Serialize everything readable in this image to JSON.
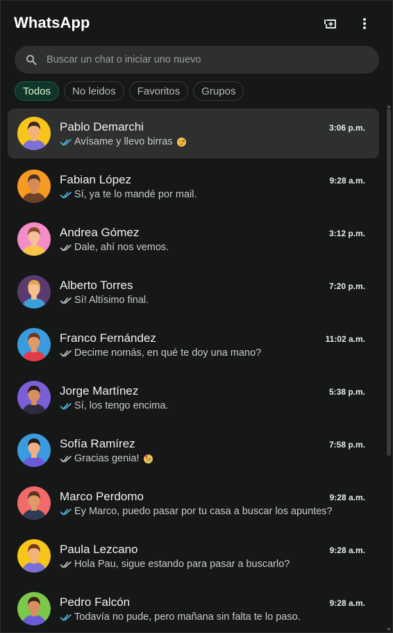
{
  "app": {
    "title": "WhatsApp"
  },
  "header": {
    "new_chat_icon": "new-chat-icon",
    "menu_icon": "kebab-menu-icon"
  },
  "search": {
    "placeholder": "Buscar un chat o iniciar uno nuevo",
    "value": ""
  },
  "filters": [
    {
      "label": "Todos",
      "active": true
    },
    {
      "label": "No leidos",
      "active": false
    },
    {
      "label": "Favoritos",
      "active": false
    },
    {
      "label": "Grupos",
      "active": false
    }
  ],
  "colors": {
    "accent": "#103529",
    "read_tick": "#53bdeb",
    "sent_tick": "#c9cccd"
  },
  "chats": [
    {
      "name": "Pablo Demarchi",
      "time": "3:06 p.m.",
      "message": "Avísame y llevo birras",
      "tick": "read",
      "emoji": "dizzy-face",
      "avatar": {
        "bg": "#f8c61a",
        "hair": "#3b2a1a",
        "skin": "#f2b27e",
        "shirt": "#7b6fd8"
      }
    },
    {
      "name": "Fabian López",
      "time": "9:28 a.m.",
      "message": "Sí, ya te lo mandé por mail.",
      "tick": "read",
      "avatar": {
        "bg": "#f59a23",
        "hair": "#4a3020",
        "skin": "#d68a56",
        "shirt": "#6b4226"
      }
    },
    {
      "name": "Andrea Gómez",
      "time": "3:12 p.m.",
      "message": "Dale, ahí nos vemos.",
      "tick": "sent",
      "avatar": {
        "bg": "#f48cc7",
        "hair": "#8a4a2a",
        "skin": "#f2c29a",
        "shirt": "#f7c548"
      }
    },
    {
      "name": "Alberto Torres",
      "time": "7:20 p.m.",
      "message": "Sí! Altísimo final.",
      "tick": "sent",
      "avatar": {
        "bg": "#5b3a6e",
        "hair": "#e6a64a",
        "skin": "#f4c08e",
        "shirt": "#3aa0d8"
      }
    },
    {
      "name": "Franco Fernández",
      "time": "11:02 a.m.",
      "message": "Decime nomás, en qué te doy una mano?",
      "tick": "sent",
      "avatar": {
        "bg": "#3a9be0",
        "hair": "#6b3b23",
        "skin": "#e09a6a",
        "shirt": "#e23b4a"
      }
    },
    {
      "name": "Jorge Martínez",
      "time": "5:38 p.m.",
      "message": "Sí, los tengo encima.",
      "tick": "read",
      "avatar": {
        "bg": "#7a5fd8",
        "hair": "#2a1a10",
        "skin": "#d88e5e",
        "shirt": "#2c2c3c"
      }
    },
    {
      "name": "Sofía Ramírez",
      "time": "7:58 p.m.",
      "message": "Gracias genia!",
      "tick": "sent",
      "emoji": "partying-face",
      "avatar": {
        "bg": "#3a9be0",
        "hair": "#2a1a14",
        "skin": "#f0b084",
        "shirt": "#6a5cd8"
      }
    },
    {
      "name": "Marco Perdomo",
      "time": "9:28 a.m.",
      "message": "Ey Marco, puedo pasar por tu casa a buscar los apuntes?",
      "tick": "read",
      "avatar": {
        "bg": "#f36a6a",
        "hair": "#5a3522",
        "skin": "#e09a6a",
        "shirt": "#2f3b55"
      }
    },
    {
      "name": "Paula Lezcano",
      "time": "9:28 a.m.",
      "message": "Hola Pau, sigue estando para pasar a buscarlo?",
      "tick": "sent",
      "avatar": {
        "bg": "#f8c61a",
        "hair": "#7a3a22",
        "skin": "#f2b27e",
        "shirt": "#7b6fd8"
      }
    },
    {
      "name": "Pedro Falcón",
      "time": "9:28 a.m.",
      "message": "Todavía no pude, pero mañana sin falta te lo paso.",
      "tick": "read",
      "avatar": {
        "bg": "#7cc84a",
        "hair": "#3a2416",
        "skin": "#d88e5e",
        "shirt": "#6a5cd8"
      }
    }
  ]
}
